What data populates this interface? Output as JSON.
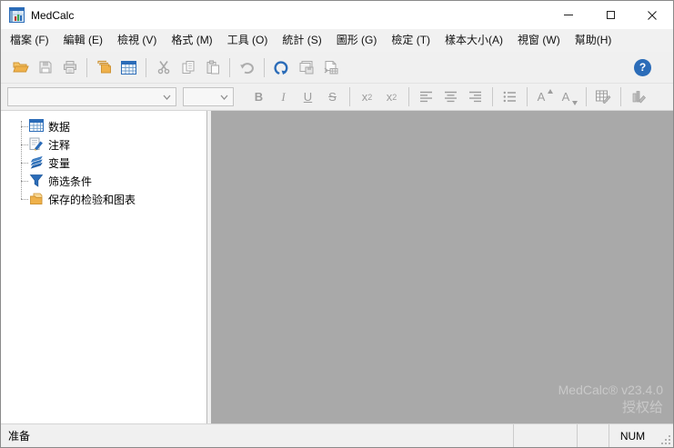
{
  "titlebar": {
    "title": "MedCalc"
  },
  "menu": {
    "items": [
      {
        "label": "檔案 (F)"
      },
      {
        "label": "編輯 (E)"
      },
      {
        "label": "檢視 (V)"
      },
      {
        "label": "格式 (M)"
      },
      {
        "label": "工具 (O)"
      },
      {
        "label": "統計 (S)"
      },
      {
        "label": "圖形 (G)"
      },
      {
        "label": "檢定 (T)"
      },
      {
        "label": "樣本大小(A)"
      },
      {
        "label": "視窗 (W)"
      },
      {
        "label": "幫助(H)"
      }
    ]
  },
  "toolbar": {
    "help_glyph": "?"
  },
  "format_toolbar": {
    "bold_label": "B",
    "italic_label": "I",
    "underline_label": "U",
    "strikethrough_label": "S",
    "subscript_base": "x",
    "subscript_script": "2",
    "superscript_base": "x",
    "superscript_script": "2",
    "grow_font_letter": "A",
    "shrink_font_letter": "A",
    "font_combo_value": "",
    "size_combo_value": ""
  },
  "tree": {
    "items": [
      {
        "label": "数据"
      },
      {
        "label": "注释"
      },
      {
        "label": "变量"
      },
      {
        "label": "筛选条件"
      },
      {
        "label": "保存的检验和图表"
      }
    ]
  },
  "workspace": {
    "watermark_line1": "MedCalc® v23.4.0",
    "watermark_line2": "授权给"
  },
  "statusbar": {
    "ready_text": "准备",
    "num_indicator": "NUM"
  },
  "colors": {
    "accent_blue": "#2b6cb8",
    "folder_orange": "#efb14a",
    "workspace_gray": "#a9a9a9",
    "disabled_icon_gray": "#9d9d9d"
  }
}
